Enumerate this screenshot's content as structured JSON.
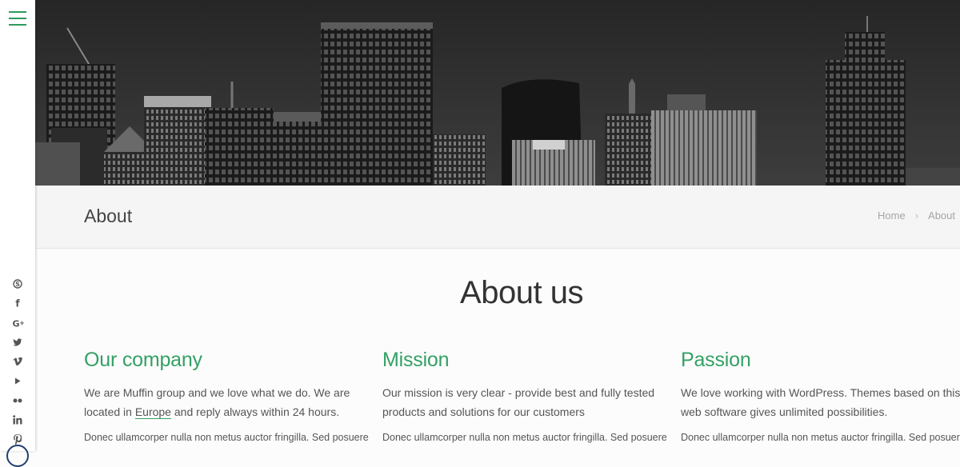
{
  "sidebar": {
    "social_icons": [
      "skype-icon",
      "facebook-icon",
      "google-plus-icon",
      "twitter-icon",
      "vimeo-icon",
      "youtube-icon",
      "flickr-icon",
      "linkedin-icon",
      "pinterest-icon"
    ]
  },
  "subheader": {
    "title": "About",
    "breadcrumb": {
      "home": "Home",
      "separator": "›",
      "current": "About"
    }
  },
  "main": {
    "title": "About us",
    "columns": [
      {
        "heading": "Our company",
        "text_before": "We are Muffin group and we love what we do. We are located in ",
        "link": "Europe",
        "text_after": " and reply always within 24 hours.",
        "extra": "Donec ullamcorper nulla non metus auctor fringilla. Sed posuere"
      },
      {
        "heading": "Mission",
        "text": "Our mission is very clear - provide best and fully tested products and solutions for our customers",
        "extra": "Donec ullamcorper nulla non metus auctor fringilla. Sed posuere"
      },
      {
        "heading": "Passion",
        "text": "We love working with WordPress. Themes based on this web software gives unlimited possibilities.",
        "extra": "Donec ullamcorper nulla non metus auctor fringilla. Sed posuere"
      }
    ]
  },
  "colors": {
    "accent": "#34a065",
    "menu_icon": "#2e9a5c"
  }
}
